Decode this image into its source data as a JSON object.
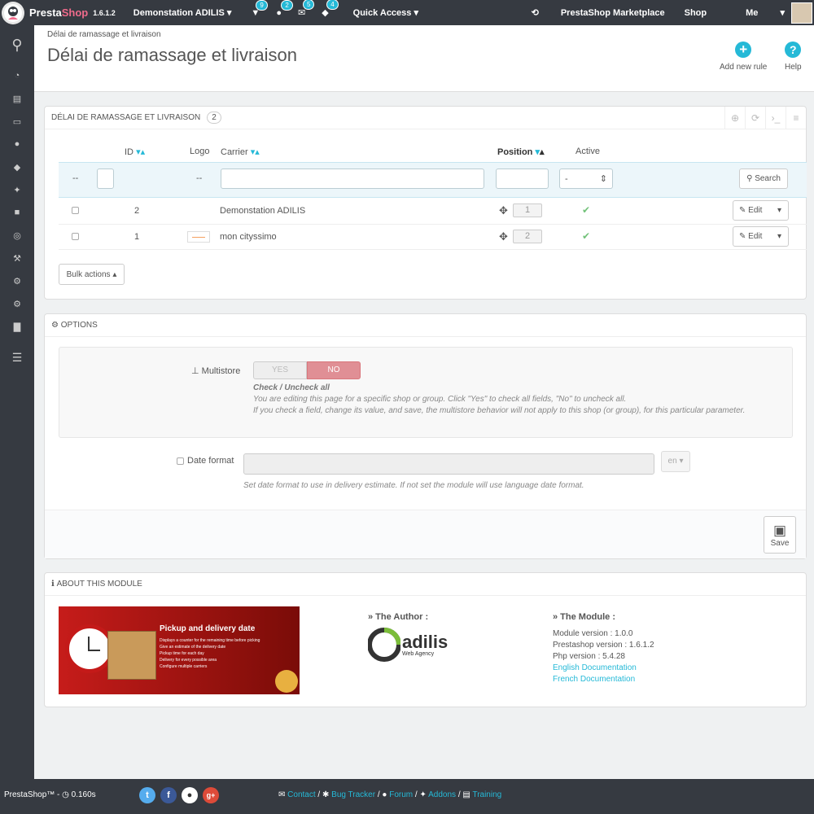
{
  "topbar": {
    "brand_part1": "Presta",
    "brand_part2": "Shop",
    "version": "1.6.1.2",
    "shop_selector": "Demonstation ADILIS",
    "notifications": [
      {
        "icon": "cart-icon",
        "glyph": "▼",
        "count": "9"
      },
      {
        "icon": "user-icon",
        "glyph": "●",
        "count": "2"
      },
      {
        "icon": "envelope-icon",
        "glyph": "✉",
        "count": "5"
      },
      {
        "icon": "trophy-icon",
        "glyph": "◆",
        "count": "4"
      }
    ],
    "quick_access": "Quick Access",
    "marketplace": "PrestaShop Marketplace",
    "shop": "Shop",
    "me": "Me"
  },
  "sidebar": {
    "items": [
      {
        "icon": "search-icon",
        "glyph": "⚲"
      },
      {
        "icon": "dashboard-icon",
        "glyph": "◔"
      },
      {
        "icon": "orders-icon",
        "glyph": "▤"
      },
      {
        "icon": "card-icon",
        "glyph": "▭"
      },
      {
        "icon": "customers-icon",
        "glyph": "●"
      },
      {
        "icon": "tag-icon",
        "glyph": "◆"
      },
      {
        "icon": "puzzle-icon",
        "glyph": "✦"
      },
      {
        "icon": "truck-icon",
        "glyph": "■"
      },
      {
        "icon": "globe-icon",
        "glyph": "◎"
      },
      {
        "icon": "wrench-icon",
        "glyph": "⚒"
      },
      {
        "icon": "cogs-icon",
        "glyph": "⚙"
      },
      {
        "icon": "cog-icon",
        "glyph": "⚙"
      },
      {
        "icon": "stats-icon",
        "glyph": "▇"
      },
      {
        "icon": "menu-icon",
        "glyph": "☰"
      }
    ]
  },
  "header": {
    "breadcrumb": "Délai de ramassage et livraison",
    "title": "Délai de ramassage et livraison",
    "add_new_rule": "Add new rule",
    "help": "Help"
  },
  "list_panel": {
    "title": "Délai de ramassage et livraison",
    "count": "2",
    "columns": {
      "id": "ID",
      "logo": "Logo",
      "carrier": "Carrier",
      "position": "Position",
      "active": "Active"
    },
    "filter_dash_1": "--",
    "filter_dash_2": "--",
    "active_select_value": "-",
    "search_label": "Search",
    "rows": [
      {
        "id": "2",
        "carrier": "Demonstation ADILIS",
        "position": "1"
      },
      {
        "id": "1",
        "carrier": "mon cityssimo",
        "position": "2"
      }
    ],
    "edit_label": "Edit",
    "bulk_actions": "Bulk actions"
  },
  "options_panel": {
    "title": "Options",
    "multistore_label": "Multistore",
    "yes": "YES",
    "no": "NO",
    "check_title": "Check / Uncheck all",
    "help1": "You are editing this page for a specific shop or group. Click \"Yes\" to check all fields, \"No\" to uncheck all.",
    "help2": "If you check a field, change its value, and save, the multistore behavior will not apply to this shop (or group), for this particular parameter.",
    "date_format_label": "Date format",
    "lang": "en",
    "date_help": "Set date format to use in delivery estimate. If not set the module will use language date format.",
    "save": "Save"
  },
  "about_panel": {
    "title": "About this module",
    "banner": {
      "title": "Pickup and delivery date",
      "lines": [
        "Displays a counter for the remaining time before picking",
        "Give an estimate of the delivery date",
        "Pickup time for each day",
        "Delivery for every possible area",
        "Configure multiple carriers"
      ]
    },
    "author_heading": "» The Author :",
    "author_logo_text": "adilis",
    "author_logo_sub": "Web Agency",
    "module_heading": "» The Module :",
    "module_version": "Module version : 1.0.0",
    "prestashop_version": "Prestashop version : 1.6.1.2",
    "php_version": "Php version : 5.4.28",
    "english_doc": "English Documentation",
    "french_doc": "French Documentation"
  },
  "footer": {
    "brand": "PrestaShop™",
    "time": "- ◷ 0.160s",
    "social": [
      {
        "icon": "twitter-icon",
        "glyph": "t",
        "color": "#55acee"
      },
      {
        "icon": "facebook-icon",
        "glyph": "f",
        "color": "#3b5998"
      },
      {
        "icon": "github-icon",
        "glyph": "●",
        "color": "#ffffff"
      },
      {
        "icon": "google-plus-icon",
        "glyph": "g+",
        "color": "#dd4b39"
      }
    ],
    "links": [
      "Contact",
      "Bug Tracker",
      "Forum",
      "Addons",
      "Training"
    ]
  },
  "colors": {
    "accent": "#25b9d7",
    "no_active": "#e08f95",
    "dark": "#363a41",
    "check": "#72c279"
  }
}
